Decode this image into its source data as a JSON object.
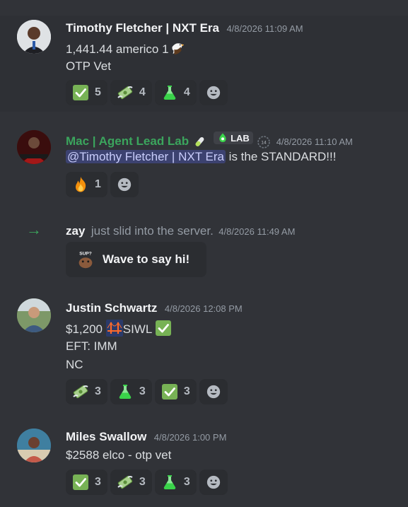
{
  "messages": [
    {
      "author": "Timothy Fletcher | NXT Era",
      "timestamp": "4/8/2026 11:09 AM",
      "lines": [
        "1,441.44 americo 1",
        "OTP Vet"
      ],
      "reactions": [
        {
          "icon": "check-mark-icon",
          "count": "5"
        },
        {
          "icon": "money-wings-icon",
          "count": "4"
        },
        {
          "icon": "flask-icon",
          "count": "4"
        }
      ]
    },
    {
      "author": "Mac | Agent Lead Lab",
      "author_color": "#3ba55d",
      "tag_label": "LAB",
      "timestamp": "4/8/2026 11:10 AM",
      "mention": "@Timothy Fletcher | NXT Era",
      "text_after_mention": " is the STANDARD!!!",
      "reactions": [
        {
          "icon": "fire-icon",
          "count": "1"
        }
      ]
    },
    {
      "type": "join",
      "author": "zay",
      "text": "just slid into the server.",
      "timestamp": "4/8/2026 11:49 AM",
      "wave_button_label": "Wave to say hi!"
    },
    {
      "author": "Justin Schwartz",
      "timestamp": "4/8/2026 12:08 PM",
      "line1_prefix": "$1,200",
      "line1_suffix": "SIWL",
      "lines": [
        "EFT: IMM",
        "NC"
      ],
      "reactions": [
        {
          "icon": "money-wings-icon",
          "count": "3"
        },
        {
          "icon": "flask-icon",
          "count": "3"
        },
        {
          "icon": "check-mark-icon",
          "count": "3"
        }
      ]
    },
    {
      "author": "Miles Swallow",
      "timestamp": "4/8/2026 1:00 PM",
      "lines": [
        "$2588 elco - otp vet"
      ],
      "reactions": [
        {
          "icon": "check-mark-icon",
          "count": "3"
        },
        {
          "icon": "money-wings-icon",
          "count": "3"
        },
        {
          "icon": "flask-icon",
          "count": "3"
        }
      ]
    }
  ]
}
